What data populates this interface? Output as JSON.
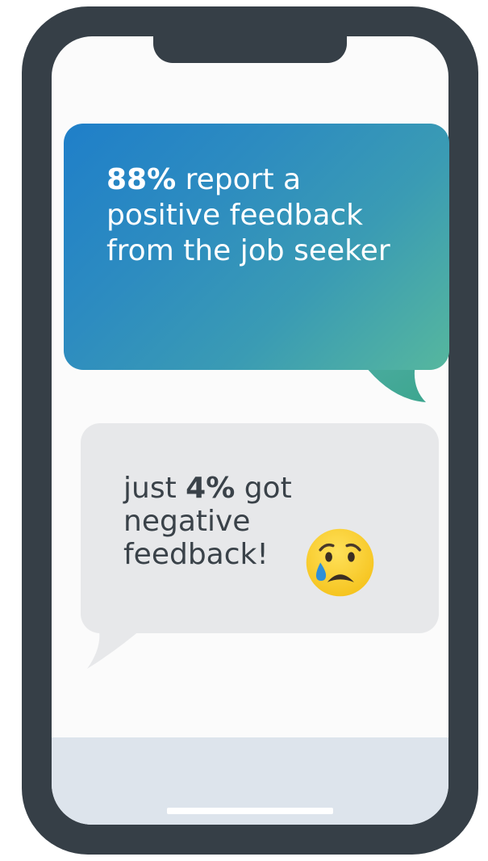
{
  "messages": [
    {
      "highlight": "88%",
      "text": " report a positive feedback from the job seeker",
      "colors": {
        "gradient_start": "#1f7fc9",
        "gradient_end": "#56b79e",
        "text": "#ffffff"
      }
    },
    {
      "prefix": "just ",
      "highlight": "4%",
      "text": " got negative feedback!",
      "emoji": "crying-face-icon",
      "colors": {
        "background": "#e7e8ea",
        "text": "#3a4249"
      }
    }
  ],
  "device": {
    "frame_color": "#363f47",
    "screen_color": "#fbfbfb",
    "bottom_bar_color": "#dde4ec"
  }
}
